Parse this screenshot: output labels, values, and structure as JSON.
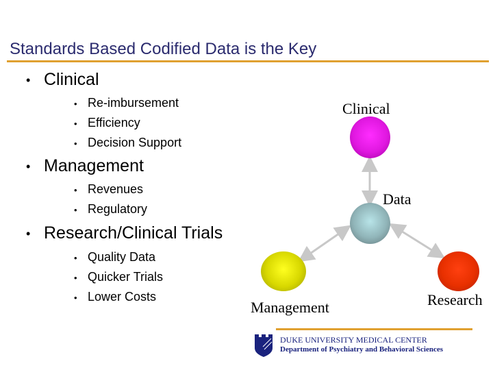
{
  "slide": {
    "title": "Standards Based Codified Data is the Key",
    "bullets": [
      {
        "label": "Clinical",
        "sub": [
          "Re-imbursement",
          "Efficiency",
          "Decision Support"
        ]
      },
      {
        "label": "Management",
        "sub": [
          "Revenues",
          "Regulatory"
        ]
      },
      {
        "label": "Research/Clinical Trials",
        "sub": [
          "Quality Data",
          "Quicker Trials",
          "Lower Costs"
        ]
      }
    ],
    "bullet_glyph": "•"
  },
  "diagram": {
    "nodes": {
      "clinical": {
        "label": "Clinical",
        "color": "#e020e0"
      },
      "data": {
        "label": "Data",
        "color": "#8fb0b4"
      },
      "management": {
        "label": "Management",
        "color": "#d8d800"
      },
      "research": {
        "label": "Research",
        "color": "#e83000"
      }
    },
    "arrow_color": "#c8c8c8"
  },
  "footer": {
    "institution": "DUKE UNIVERSITY MEDICAL CENTER",
    "department": "Department of Psychiatry and Behavioral Sciences"
  },
  "colors": {
    "title": "#2b2b6e",
    "accent_rule": "#e0a030",
    "logo": "#1a237e"
  }
}
